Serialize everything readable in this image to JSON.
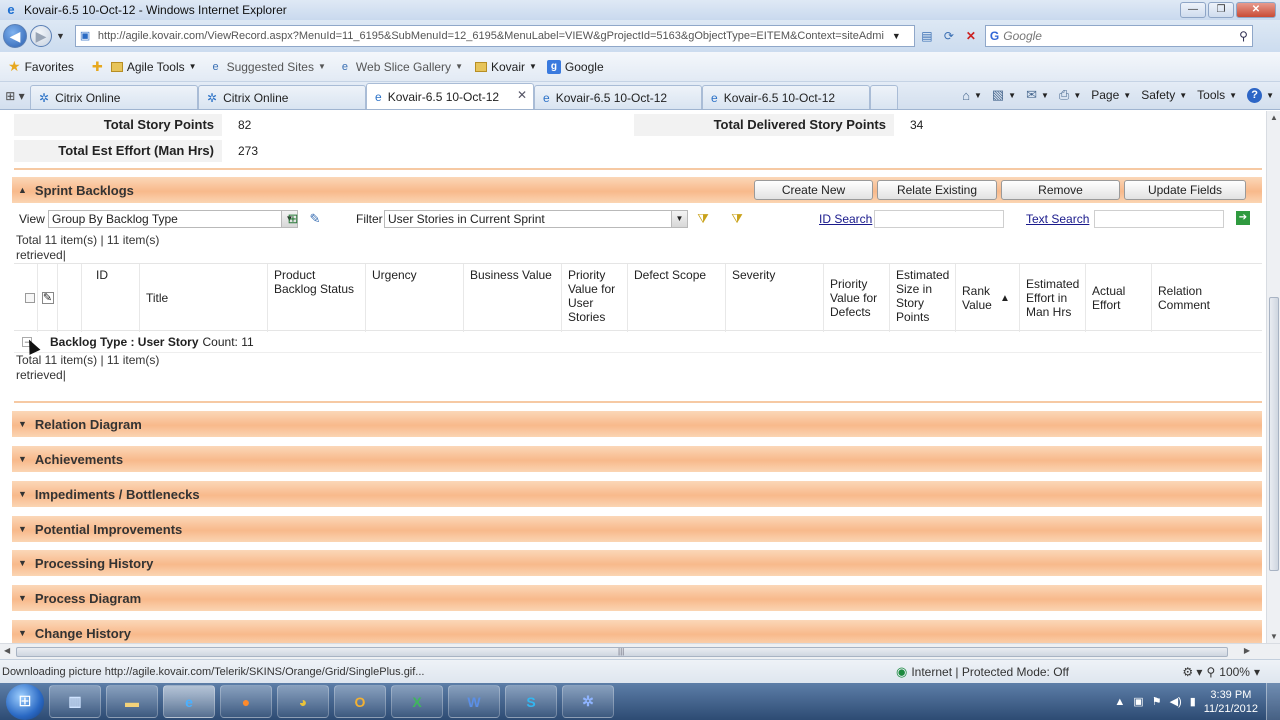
{
  "window": {
    "title": "Kovair-6.5 10-Oct-12 - Windows Internet Explorer"
  },
  "address": {
    "url": "http://agile.kovair.com/ViewRecord.aspx?MenuId=11_6195&SubMenuId=12_6195&MenuLabel=VIEW&gProjectId=5163&gObjectType=EITEM&Context=siteAdmi",
    "search_placeholder": "Google"
  },
  "favorites": {
    "label": "Favorites",
    "items": [
      "Agile Tools",
      "Suggested Sites",
      "Web Slice Gallery",
      "Kovair",
      "Google"
    ]
  },
  "tabs": [
    {
      "label": "Citrix Online"
    },
    {
      "label": "Citrix Online"
    },
    {
      "label": "Kovair-6.5 10-Oct-12"
    },
    {
      "label": "Kovair-6.5 10-Oct-12"
    },
    {
      "label": "Kovair-6.5 10-Oct-12"
    }
  ],
  "commands": {
    "page": "Page",
    "safety": "Safety",
    "tools": "Tools"
  },
  "totals": {
    "story_points_label": "Total Story Points",
    "story_points_value": "82",
    "delivered_label": "Total Delivered Story Points",
    "delivered_value": "34",
    "effort_label": "Total Est Effort (Man Hrs)",
    "effort_value": "273"
  },
  "sprint_backlogs": {
    "title": "Sprint Backlogs",
    "buttons": {
      "create_new": "Create New",
      "relate_existing": "Relate Existing",
      "remove": "Remove",
      "update_fields": "Update Fields"
    },
    "view_label": "View",
    "view_value": "Group By Backlog Type",
    "filter_label": "Filter",
    "filter_value": "User Stories in Current Sprint",
    "id_search": "ID Search",
    "text_search": "Text Search",
    "count_text": "Total 11 item(s) | 11 item(s)",
    "retrieved": "retrieved",
    "columns": {
      "id": "ID",
      "title": "Title",
      "product_backlog_status": "Product Backlog Status",
      "urgency": "Urgency",
      "business_value": "Business Value",
      "priority_user_stories": "Priority Value for User Stories",
      "defect_scope": "Defect Scope",
      "severity": "Severity",
      "priority_defects": "Priority Value for Defects",
      "estimated_size": "Estimated Size in Story Points",
      "rank_value": "Rank Value",
      "estimated_effort": "Estimated Effort in Man Hrs",
      "actual_effort": "Actual Effort",
      "relation_comment": "Relation Comment"
    },
    "group": {
      "label": "Backlog Type : User Story",
      "count": "Count: 11"
    },
    "group_count_text": "Total 11 item(s) | 11 item(s)",
    "group_retrieved": "retrieved"
  },
  "sections": [
    "Relation Diagram",
    "Achievements",
    "Impediments / Bottlenecks",
    "Potential Improvements",
    "Processing History",
    "Process Diagram",
    "Change History"
  ],
  "status": {
    "message": "Downloading picture http://agile.kovair.com/Telerik/SKINS/Orange/Grid/SinglePlus.gif...",
    "zone": "Internet | Protected Mode: Off",
    "zoom": "100%"
  },
  "clock": {
    "time": "3:39 PM",
    "date": "11/21/2012"
  }
}
